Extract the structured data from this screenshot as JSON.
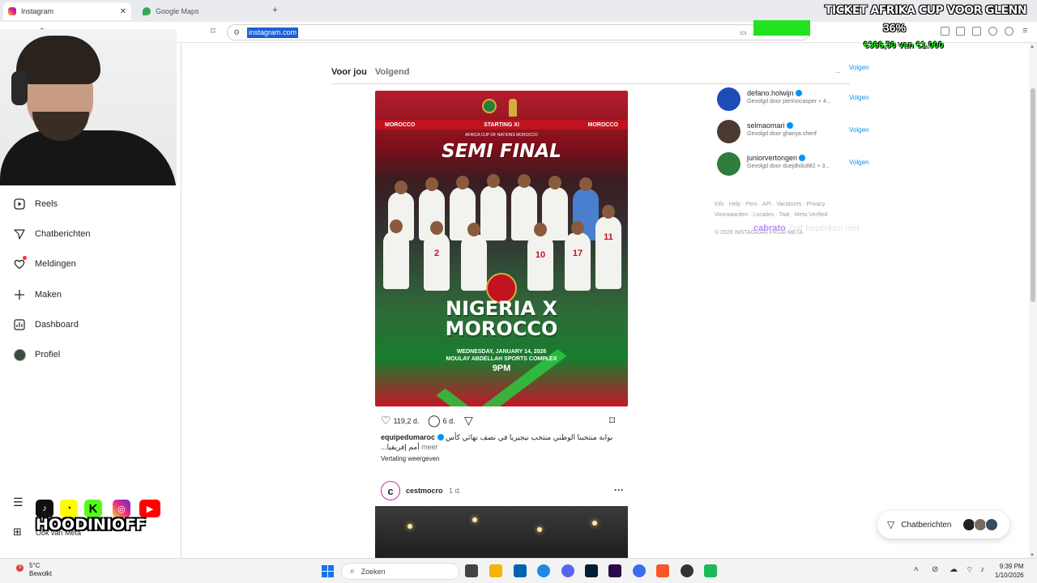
{
  "browser": {
    "tabs": [
      {
        "label": "Instagram",
        "icon": "instagram-favicon",
        "active": true
      },
      {
        "label": "Google Maps",
        "icon": "maps-favicon",
        "active": false
      }
    ],
    "url": "instagram.com"
  },
  "overlay": {
    "title": "TICKET AFRIKA CUP VOOR GLENN",
    "progress_percent": "36%",
    "progress_fraction": 0.36,
    "amount": "€366,50 van €1.000",
    "chat_user": "cabrato",
    "chat_message": "Zelf beperken niet"
  },
  "sidebar": {
    "items": [
      {
        "label": "Reels",
        "icon": "reels-icon"
      },
      {
        "label": "Chatberichten",
        "icon": "send-icon"
      },
      {
        "label": "Meldingen",
        "icon": "heart-icon"
      },
      {
        "label": "Maken",
        "icon": "plus-icon"
      },
      {
        "label": "Dashboard",
        "icon": "dashboard-icon"
      },
      {
        "label": "Profiel",
        "icon": "profile-avatar"
      }
    ],
    "more_label": "Meer",
    "meta_label": "Ook van Meta"
  },
  "social": {
    "name": "HOODINIOFF",
    "icons": [
      "tiktok-icon",
      "snapchat-icon",
      "kick-icon",
      "instagram-icon",
      "youtube-icon"
    ]
  },
  "feed": {
    "tabs": [
      {
        "label": "Voor jou",
        "active": true
      },
      {
        "label": "Volgend",
        "active": false
      }
    ],
    "post1": {
      "image": {
        "banner_left": "MOROCCO",
        "banner_center": "STARTING XI",
        "banner_right": "MOROCCO",
        "competition": "AFRICA CUP OF NATIONS MOROCCO",
        "headline": "SEMI FINAL",
        "matchup_line1": "NIGERIA X",
        "matchup_line2": "MOROCCO",
        "date": "WEDNESDAY, JANUARY 14, 2026",
        "venue": "MOULAY ABDELLAH SPORTS COMPLEX",
        "time": "9PM",
        "numbers": [
          "2",
          "10",
          "17",
          "11"
        ]
      },
      "likes": "119,2 d.",
      "comments": "6 d.",
      "username": "equipedumaroc",
      "caption": "بوابة منتخبنا الوطني منتخب نيجيريا في نصف نهائي كأس أمم إفريقيا...",
      "more": "meer",
      "translate": "Vertaling weergeven"
    },
    "post2": {
      "username": "cestmocro",
      "time": "1 d.",
      "avatar_letter": "c"
    }
  },
  "suggestions": {
    "top_follow": "Volgen",
    "dots": "...",
    "items": [
      {
        "name": "defano.holwijn",
        "sub": "Gevolgd door pierinocasper + 4...",
        "follow": "Volgen",
        "color": "#1d4bb8"
      },
      {
        "name": "selmaomari",
        "sub": "Gevolgd door ghanya.sherif",
        "follow": "Volgen",
        "color": "#4a3a32"
      },
      {
        "name": "juniorvertongen",
        "sub": "Gevolgd door duejdhdu882 + 3...",
        "follow": "Volgen",
        "color": "#2f7d3a"
      }
    ],
    "footer_line1": "Info · Help · Pers · API · Vacatures · Privacy ·",
    "footer_line2": "Voorwaarden · Locaties · Taal · Meta Verified",
    "copyright": "© 2026 INSTAGRAM FROM META"
  },
  "chat_pill": {
    "label": "Chatberichten"
  },
  "taskbar": {
    "weather_temp": "5°C",
    "weather_desc": "Bewolkt",
    "weather_badge": "3",
    "search_placeholder": "Zoeken",
    "time": "9:39 PM",
    "date": "1/10/2026"
  },
  "colors": {
    "accent": "#0095f6",
    "progress_green": "#22e320",
    "notification_red": "#ff3040"
  }
}
